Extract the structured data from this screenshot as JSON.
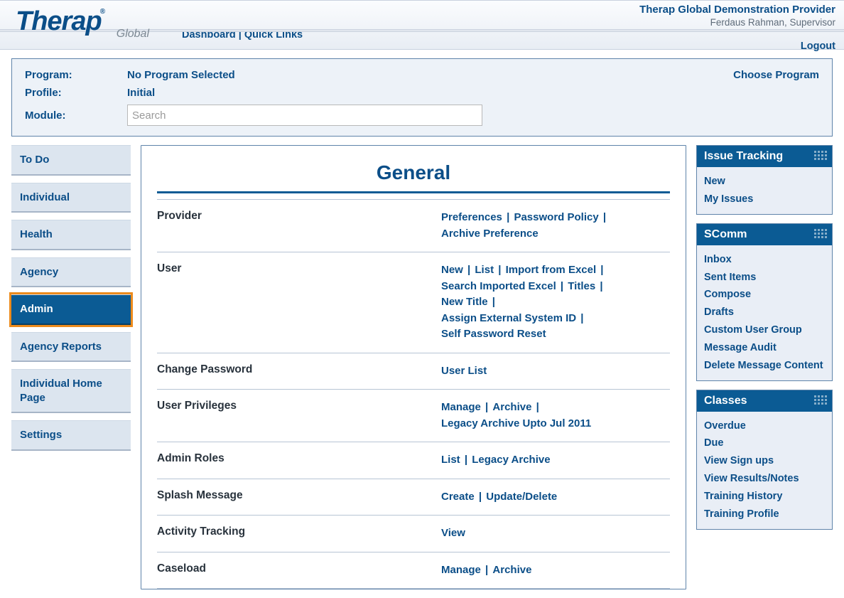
{
  "header": {
    "logo_main": "Therap",
    "logo_sub": "Global",
    "provider": "Therap Global Demonstration Provider",
    "user": "Ferdaus Rahman, Supervisor",
    "logout": "Logout",
    "dashboard": "Dashboard",
    "sep": " | ",
    "quick_links": "Quick Links"
  },
  "programBox": {
    "program_label": "Program:",
    "program_value": "No Program Selected",
    "profile_label": "Profile:",
    "profile_value": "Initial",
    "module_label": "Module:",
    "search_placeholder": "Search",
    "choose": "Choose Program"
  },
  "tabs": [
    "To Do",
    "Individual",
    "Health",
    "Agency",
    "Admin",
    "Agency Reports",
    "Individual Home Page",
    "Settings"
  ],
  "tabs_selected_index": 4,
  "main": {
    "title": "General",
    "rows": [
      {
        "label": "Provider",
        "links": [
          "Preferences",
          "Password Policy",
          "Archive Preference"
        ]
      },
      {
        "label": "User",
        "links": [
          "New",
          "List",
          "Import from Excel",
          "Search Imported Excel",
          "Titles",
          "New Title",
          "Assign External System ID",
          "Self Password Reset"
        ]
      },
      {
        "label": "Change Password",
        "links": [
          "User List"
        ]
      },
      {
        "label": "User Privileges",
        "links": [
          "Manage",
          "Archive",
          "Legacy Archive Upto Jul 2011"
        ]
      },
      {
        "label": "Admin Roles",
        "links": [
          "List",
          "Legacy Archive"
        ]
      },
      {
        "label": "Splash Message",
        "links": [
          "Create",
          "Update/Delete"
        ]
      },
      {
        "label": "Activity Tracking",
        "links": [
          "View"
        ]
      },
      {
        "label": "Caseload",
        "links": [
          "Manage",
          "Archive"
        ]
      }
    ]
  },
  "panels": [
    {
      "title": "Issue Tracking",
      "links": [
        "New",
        "My Issues"
      ]
    },
    {
      "title": "SComm",
      "links": [
        "Inbox",
        "Sent Items",
        "Compose",
        "Drafts",
        "Custom User Group",
        "Message Audit",
        "Delete Message Content"
      ]
    },
    {
      "title": "Classes",
      "links": [
        "Overdue",
        "Due",
        "View Sign ups",
        "View Results/Notes",
        "Training History",
        "Training Profile"
      ]
    }
  ]
}
